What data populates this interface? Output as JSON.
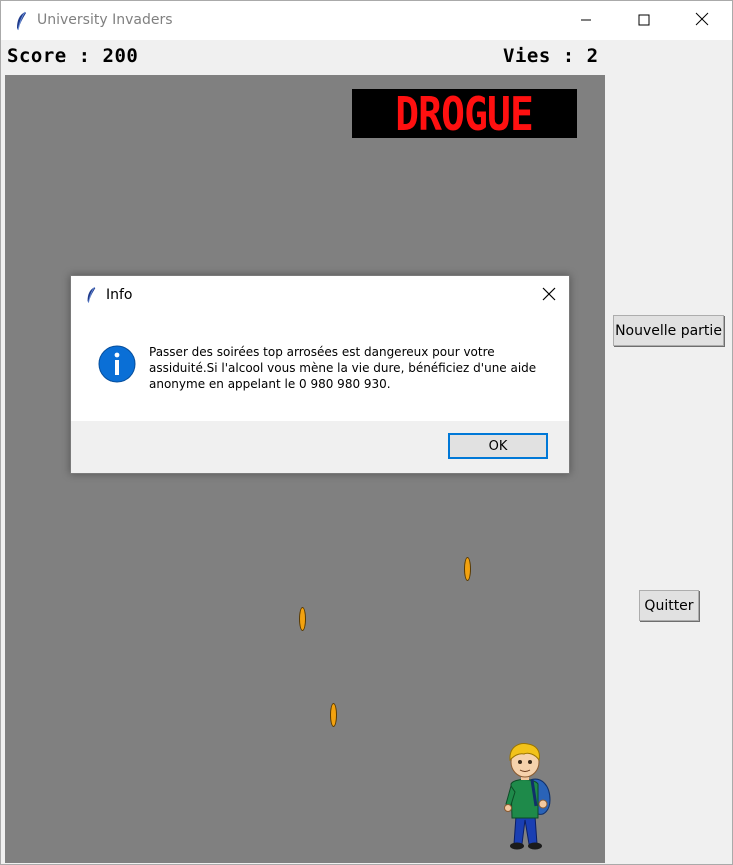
{
  "window": {
    "title": "University Invaders",
    "icon": "feather-icon",
    "controls": [
      "minimize-icon",
      "maximize-icon",
      "close-icon"
    ]
  },
  "hud": {
    "score_text": "Score : 200",
    "lives_text": "Vies : 2"
  },
  "game": {
    "banner_text": "DROGUE",
    "canvas_color": "#808080",
    "banner_text_color": "#ff1010",
    "projectile_color": "#f3a20f",
    "player": "student-sprite"
  },
  "side": {
    "new_game_label": "Nouvelle partie",
    "quit_label": "Quitter"
  },
  "dialog": {
    "title": "Info",
    "icon": "info-icon",
    "message": "Passer des soirées top arrosées est dangereux pour votre assiduité.Si l'alcool vous mène la vie dure, bénéficiez d'une aide anonyme en appelant le 0 980 980 930.",
    "ok_label": "OK",
    "accent_color": "#0078d7"
  }
}
